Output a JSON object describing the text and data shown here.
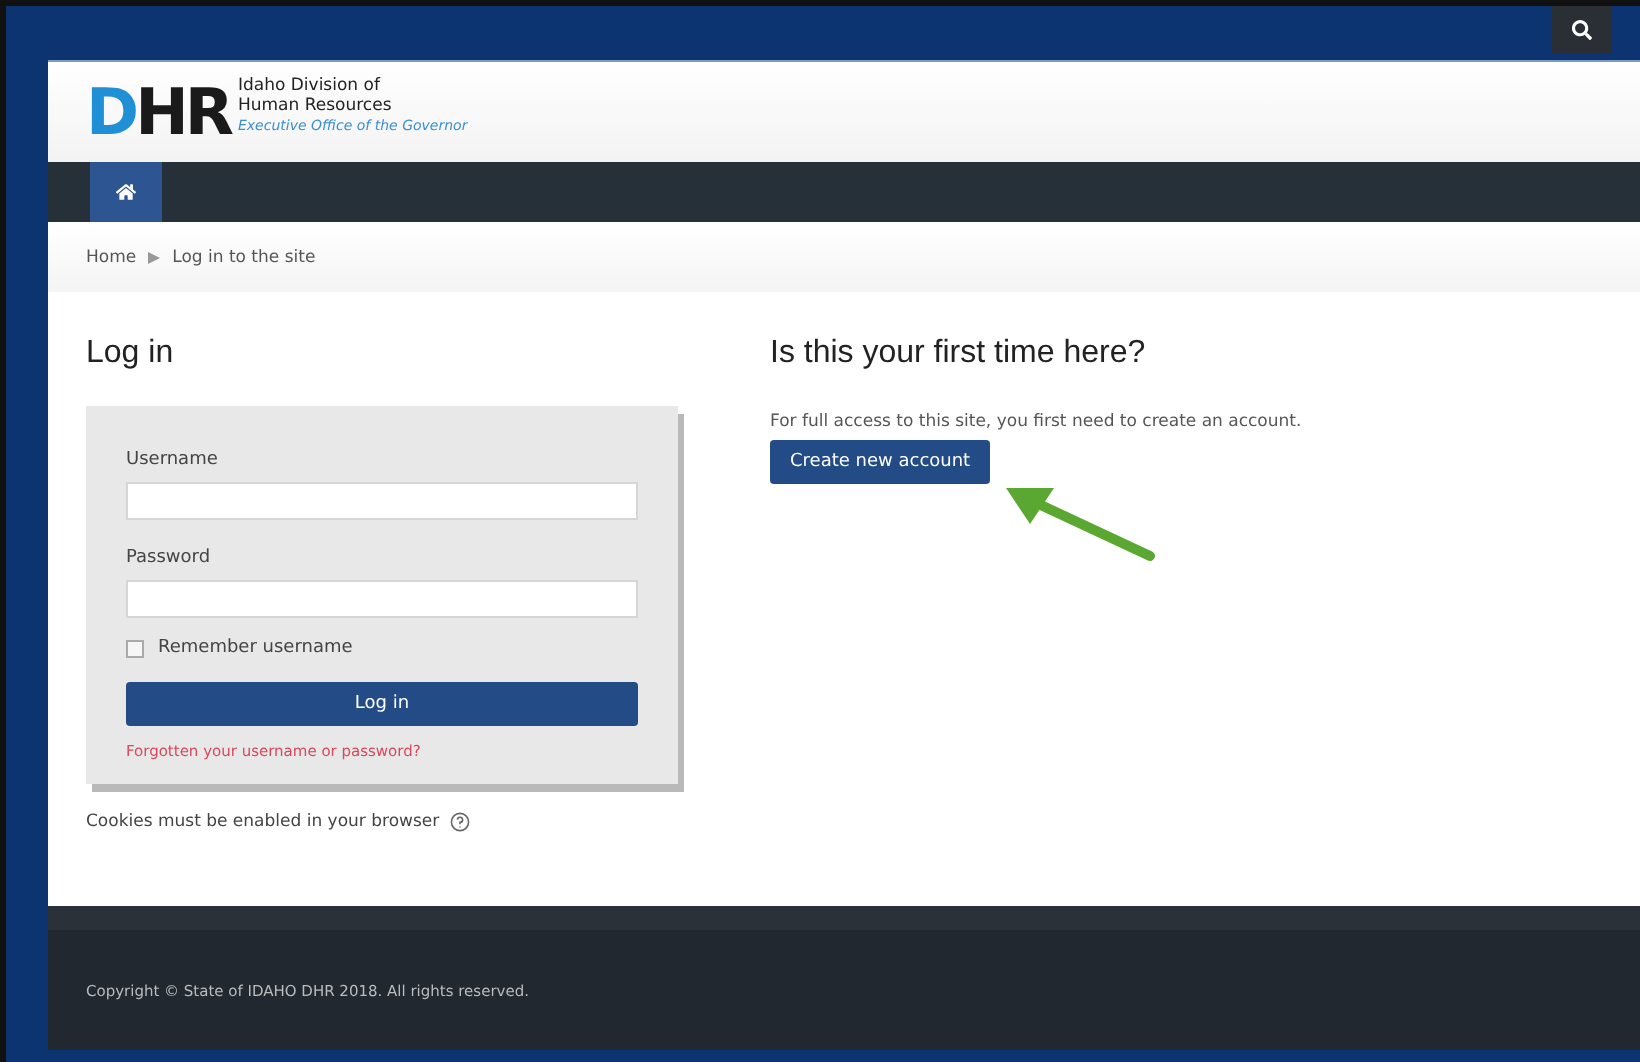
{
  "header": {
    "logo_mark": "D",
    "logo_rest": "HR",
    "org_line1": "Idaho Division of",
    "org_line2": "Human Resources",
    "tagline": "Executive Office of the Governor"
  },
  "navbar": {
    "home_selected": true
  },
  "breadcrumb": [
    "Home",
    "Log in to the site"
  ],
  "login": {
    "title": "Log in",
    "username_label": "Username",
    "password_label": "Password",
    "remember": {
      "label": "Remember username",
      "checked": false
    },
    "submit": "Log in",
    "forgot": "Forgotten your username or password?",
    "cookies": "Cookies must be enabled in your browser"
  },
  "signup": {
    "title": "Is this your first time here?",
    "text": "For full access to this site, you first need to create an account.",
    "button": "Create new account"
  },
  "footer": {
    "copyright": "Copyright © State of IDAHO DHR 2018. All rights reserved."
  }
}
